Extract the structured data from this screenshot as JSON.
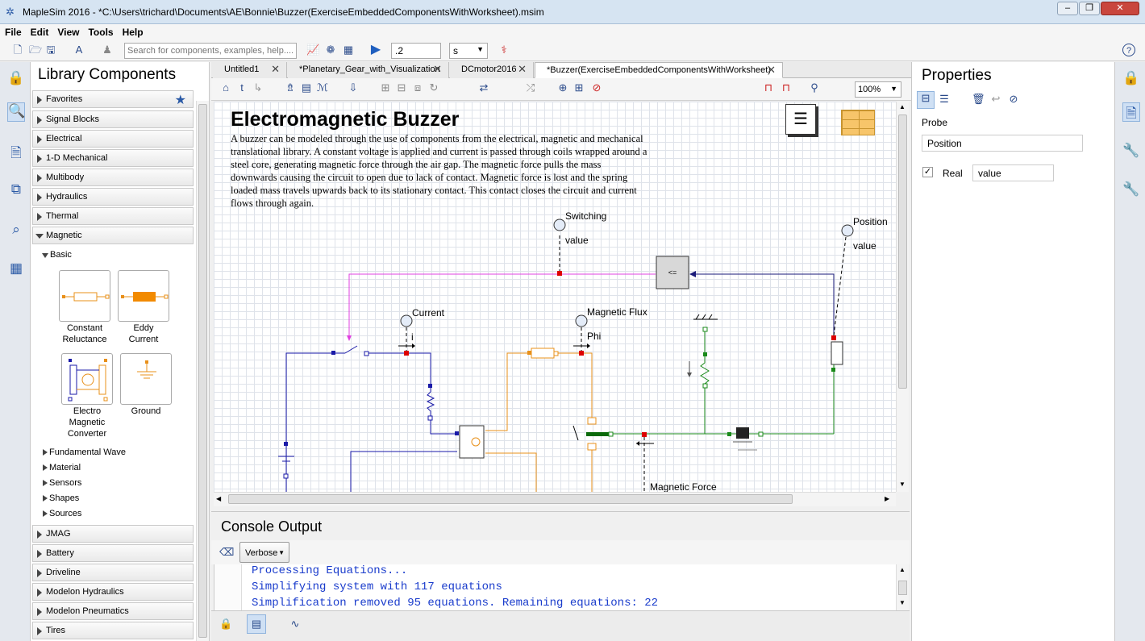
{
  "window": {
    "title": "MapleSim 2016 -  *C:\\Users\\trichard\\Documents\\AE\\Bonnie\\Buzzer(ExerciseEmbeddedComponentsWithWorksheet).msim"
  },
  "menu": [
    "File",
    "Edit",
    "View",
    "Tools",
    "Help"
  ],
  "toolbar": {
    "search_placeholder": "Search for components, examples, help....",
    "sim_time": ".2",
    "time_unit": "s"
  },
  "library": {
    "title": "Library Components",
    "categories_top": [
      "Favorites",
      "Signal Blocks",
      "Electrical",
      "1-D Mechanical",
      "Multibody",
      "Hydraulics",
      "Thermal",
      "Magnetic"
    ],
    "magnetic_subs": [
      "Basic",
      "Fundamental Wave",
      "Material",
      "Sensors",
      "Shapes",
      "Sources"
    ],
    "components": [
      "Constant Reluctance",
      "Eddy Current",
      "Electro Magnetic Converter",
      "Ground"
    ],
    "categories_bottom": [
      "JMAG",
      "Battery",
      "Driveline",
      "Modelon Hydraulics",
      "Modelon Pneumatics",
      "Tires"
    ]
  },
  "tabs": [
    {
      "label": "Untitled1"
    },
    {
      "label": "*Planetary_Gear_with_Visualization"
    },
    {
      "label": "DCmotor2016"
    },
    {
      "label": "*Buzzer(ExerciseEmbeddedComponentsWithWorksheet)"
    }
  ],
  "diagram": {
    "zoom": "100%",
    "title": "Electromagnetic Buzzer",
    "description": "A buzzer can be modeled through the use of components from the electrical, magnetic and mechanical translational library. A constant voltage is applied and current is passed through coils wrapped around a steel core, generating magnetic force through the air gap. The magnetic force pulls the mass downwards causing the circuit to open due to lack of contact. Magnetic force is lost and the spring loaded mass travels upwards back to its stationary contact. This contact closes the circuit and current flows through again.",
    "labels": {
      "switching": "Switching",
      "switching_val": "value",
      "position": "Position",
      "position_val": "value",
      "current": "Current",
      "current_val": "i",
      "flux": "Magnetic Flux",
      "flux_val": "Phi",
      "force": "Magnetic Force",
      "compare": "<="
    }
  },
  "console": {
    "title": "Console Output",
    "verbosity": "Verbose",
    "lines": [
      "Processing Equations...",
      "Simplifying system with 117 equations",
      "Simplification removed 95 equations. Remaining equations: 22"
    ]
  },
  "properties": {
    "title": "Properties",
    "section": "Probe",
    "name_value": "Position",
    "real_label": "Real",
    "real_value": "value",
    "real_checked": true
  },
  "colors": {
    "electrical": "#1a1aa8",
    "magnetic": "#e8901a",
    "translational": "#1a8a1a",
    "signal": "#e040e0",
    "console_text": "#1a3ccc"
  }
}
